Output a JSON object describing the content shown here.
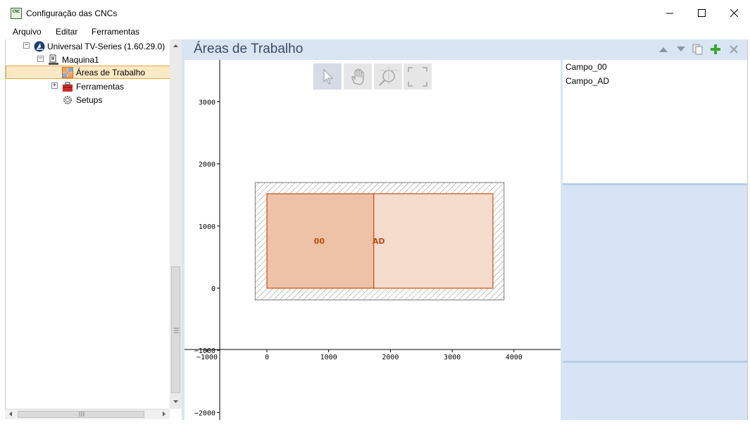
{
  "window": {
    "title": "Configuração das CNCs",
    "app_icon_text": "CNC"
  },
  "menu": [
    "Arquivo",
    "Editar",
    "Ferramentas"
  ],
  "tree": {
    "root": "Universal TV-Series (1.60.29.0)",
    "machine": "Maquina1",
    "work_areas": "Áreas de Trabalho",
    "tools": "Ferramentas",
    "setups": "Setups"
  },
  "main": {
    "title": "Áreas de Trabalho",
    "header_icons": [
      "arrow-up-icon",
      "arrow-down-icon",
      "copy-icon",
      "add-icon",
      "delete-icon"
    ]
  },
  "canvas_tools": [
    "pointer-icon",
    "hand-icon",
    "zoom-icon",
    "fit-icon"
  ],
  "plot": {
    "y_ticks": [
      "3000",
      "2000",
      "1000",
      "0",
      "−1000",
      "−2000"
    ],
    "x_ticks": [
      "−1000",
      "0",
      "1000",
      "2000",
      "3000",
      "4000"
    ],
    "fields": [
      {
        "label": "00",
        "x0": 0,
        "x1": 1730,
        "y0": 0,
        "y1": 1520,
        "fill": "#edc2a6"
      },
      {
        "label": "AD",
        "x0": 1730,
        "x1": 3660,
        "y0": 0,
        "y1": 1520,
        "fill": "#f5dccd"
      }
    ],
    "limits": {
      "x0": -190,
      "x1": 3840,
      "y0": -190,
      "y1": 1700
    },
    "border_color": "#c0531a",
    "label_color": "#c04a10"
  },
  "fields_list": [
    "Campo_00",
    "Campo_AD"
  ]
}
